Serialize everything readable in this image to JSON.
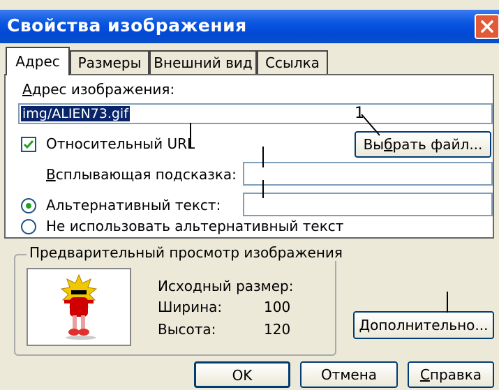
{
  "window": {
    "title": "Свойства изображения"
  },
  "tabs": [
    {
      "label": "Адрес"
    },
    {
      "label": "Размеры"
    },
    {
      "label": "Внешний вид"
    },
    {
      "label": "Ссылка"
    }
  ],
  "address": {
    "label_mnemonic": "А",
    "label_rest": "дрес изображения:",
    "value": "img/ALIEN73.gif"
  },
  "relative_url": {
    "label": "Относительный URL",
    "checked": true
  },
  "choose_file": {
    "pre": "Вы",
    "mnemonic": "б",
    "post": "рать файл..."
  },
  "tooltip": {
    "label_mnemonic": "В",
    "label_rest": "сплывающая подсказка:",
    "value": ""
  },
  "alt_text": {
    "label": "Альтернативный текст:",
    "value": "",
    "selected": true
  },
  "no_alt": {
    "label": "Не использовать альтернативный текст"
  },
  "preview": {
    "title": "Предварительный просмотр изображения",
    "original_size_label": "Исходный размер:",
    "width_label": "Ширина:",
    "width_value": "100",
    "height_label": "Высота:",
    "height_value": "120"
  },
  "advanced": {
    "mnemonic": "Д",
    "rest": "ополнительно..."
  },
  "annotation": {
    "number": "1"
  },
  "footer": {
    "ok": "OK",
    "cancel": "Отмена",
    "help_mnemonic": "С",
    "help_rest": "правка"
  },
  "colors": {
    "title_bar": "#0a56e0",
    "close_button": "#e25a37",
    "selection": "#0a246a",
    "checkmark": "#21a121"
  }
}
